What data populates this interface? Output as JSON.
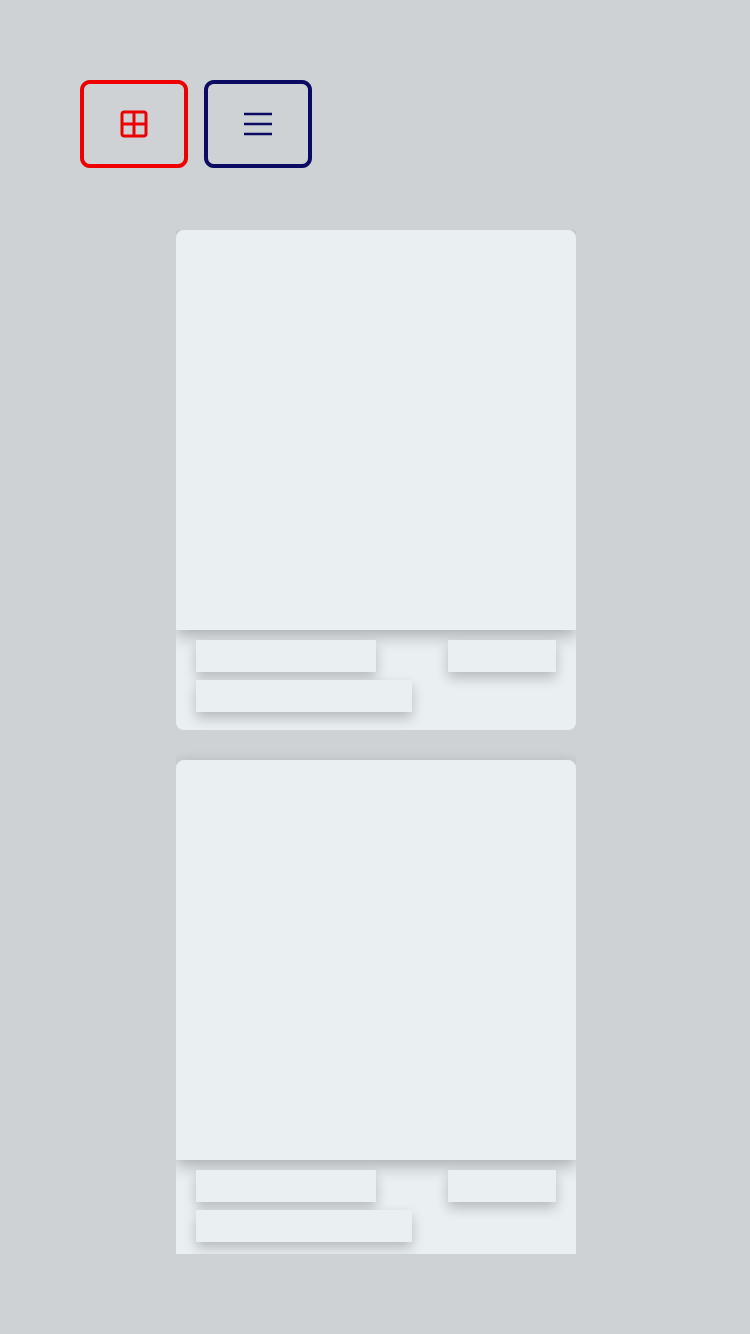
{
  "toolbar": {
    "grid_view": {
      "icon": "grid-icon",
      "active": true,
      "color": "#ee0000"
    },
    "list_view": {
      "icon": "list-icon",
      "active": false,
      "color": "#0b0b63"
    }
  },
  "colors": {
    "background": "#cfd2d5",
    "card_surface": "#eaeff2"
  },
  "cards": [
    {
      "state": "loading-placeholder"
    },
    {
      "state": "loading-placeholder"
    }
  ]
}
